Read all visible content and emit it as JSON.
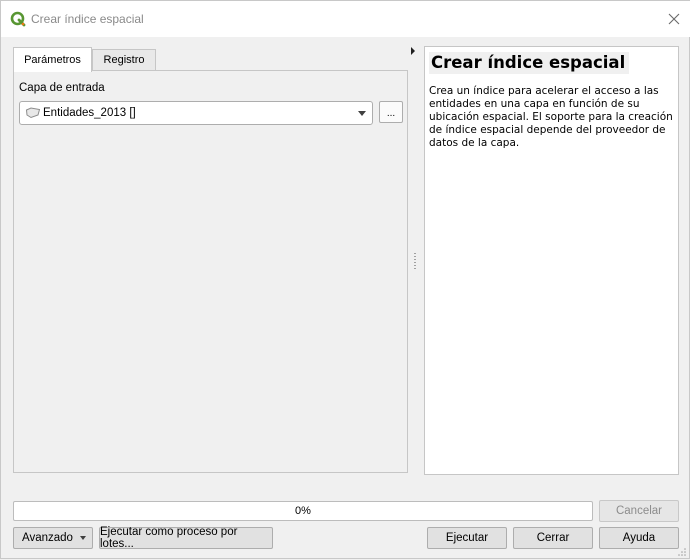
{
  "window": {
    "title": "Crear índice espacial",
    "icon": "qgis-icon",
    "close_icon": "close-icon"
  },
  "tabs": [
    {
      "label": "Parámetros",
      "active": true
    },
    {
      "label": "Registro",
      "active": false
    }
  ],
  "parameters": {
    "input_layer_label": "Capa de entrada",
    "input_layer_value": "Entidades_2013 []",
    "input_layer_icon": "polygon-layer-icon",
    "browse_button_label": "..."
  },
  "help": {
    "title": "Crear índice espacial",
    "body": "Crea un índice para acelerar el acceso a las entidades en una capa en función de su ubicación espacial. El soporte para la creación de índice espacial depende del proveedor de datos de la capa."
  },
  "progress": {
    "value": 0,
    "text": "0%"
  },
  "buttons": {
    "cancel": "Cancelar",
    "advanced": "Avanzado",
    "batch": "Ejecutar como proceso por lotes...",
    "run": "Ejecutar",
    "close": "Cerrar",
    "help": "Ayuda"
  },
  "colors": {
    "qgis_green": "#589632",
    "qgis_yellow": "#ee7913",
    "progress_green": "#06b025"
  }
}
